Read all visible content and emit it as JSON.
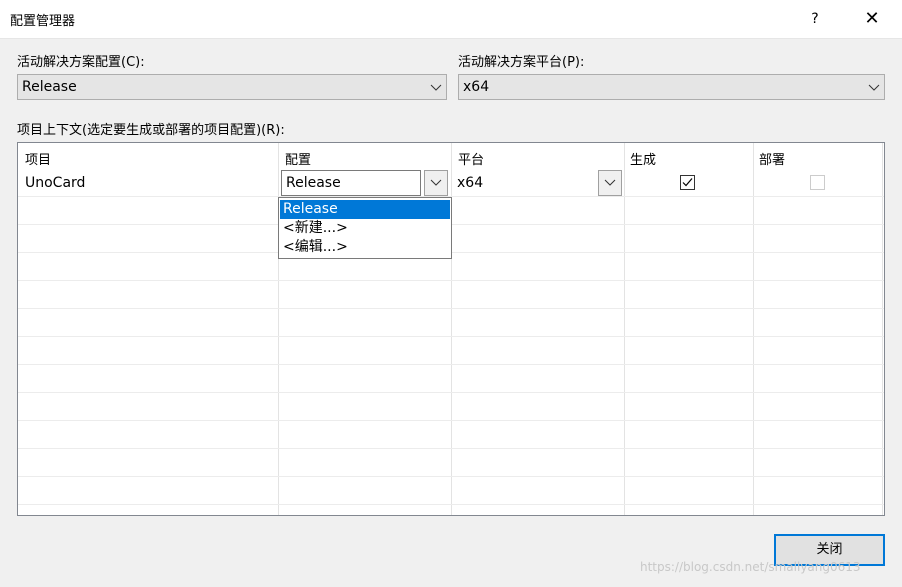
{
  "window": {
    "title": "配置管理器",
    "help_label": "?",
    "close_label": "✕"
  },
  "active_config": {
    "label": "活动解决方案配置(C):",
    "value": "Release"
  },
  "active_platform": {
    "label": "活动解决方案平台(P):",
    "value": "x64"
  },
  "project_context": {
    "label": "项目上下文(选定要生成或部署的项目配置)(R):",
    "columns": [
      "项目",
      "配置",
      "平台",
      "生成",
      "部署"
    ],
    "rows": [
      {
        "project": "UnoCard",
        "config": "Release",
        "platform": "x64",
        "build": true,
        "deploy": false
      }
    ],
    "config_dropdown": {
      "options": [
        "Release",
        "<新建...>",
        "<编辑...>"
      ],
      "selected": "Release"
    }
  },
  "buttons": {
    "close": "关闭"
  },
  "watermark": "https://blog.csdn.net/smallyang0613",
  "colors": {
    "accent": "#0078d7",
    "background": "#f0f0f0"
  }
}
